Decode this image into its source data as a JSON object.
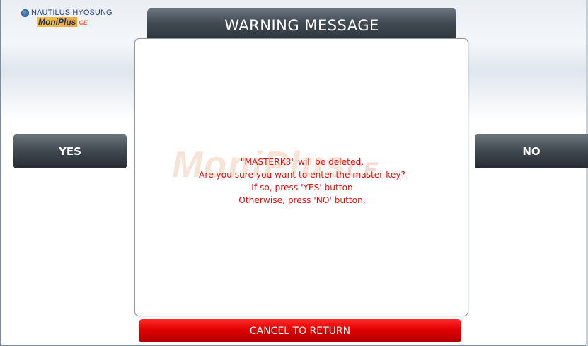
{
  "logo": {
    "brand": "NAUTILUS HYOSUNG",
    "product": "MoniPlus",
    "product_suffix": "CE"
  },
  "title": "WARNING MESSAGE",
  "watermark": {
    "text": "MoniPlus",
    "suffix": "CE"
  },
  "message": {
    "lines": [
      "\"MASTERK3\" will be deleted.",
      "Are you sure  you want to enter the master key?",
      "If so, press 'YES' button",
      "Otherwise, press 'NO' button."
    ]
  },
  "buttons": {
    "yes": "YES",
    "no": "NO",
    "cancel": "CANCEL TO RETURN"
  },
  "colors": {
    "message_text": "#e0100f",
    "cancel_button": "#e00000",
    "dark_button": "#3f474f"
  }
}
